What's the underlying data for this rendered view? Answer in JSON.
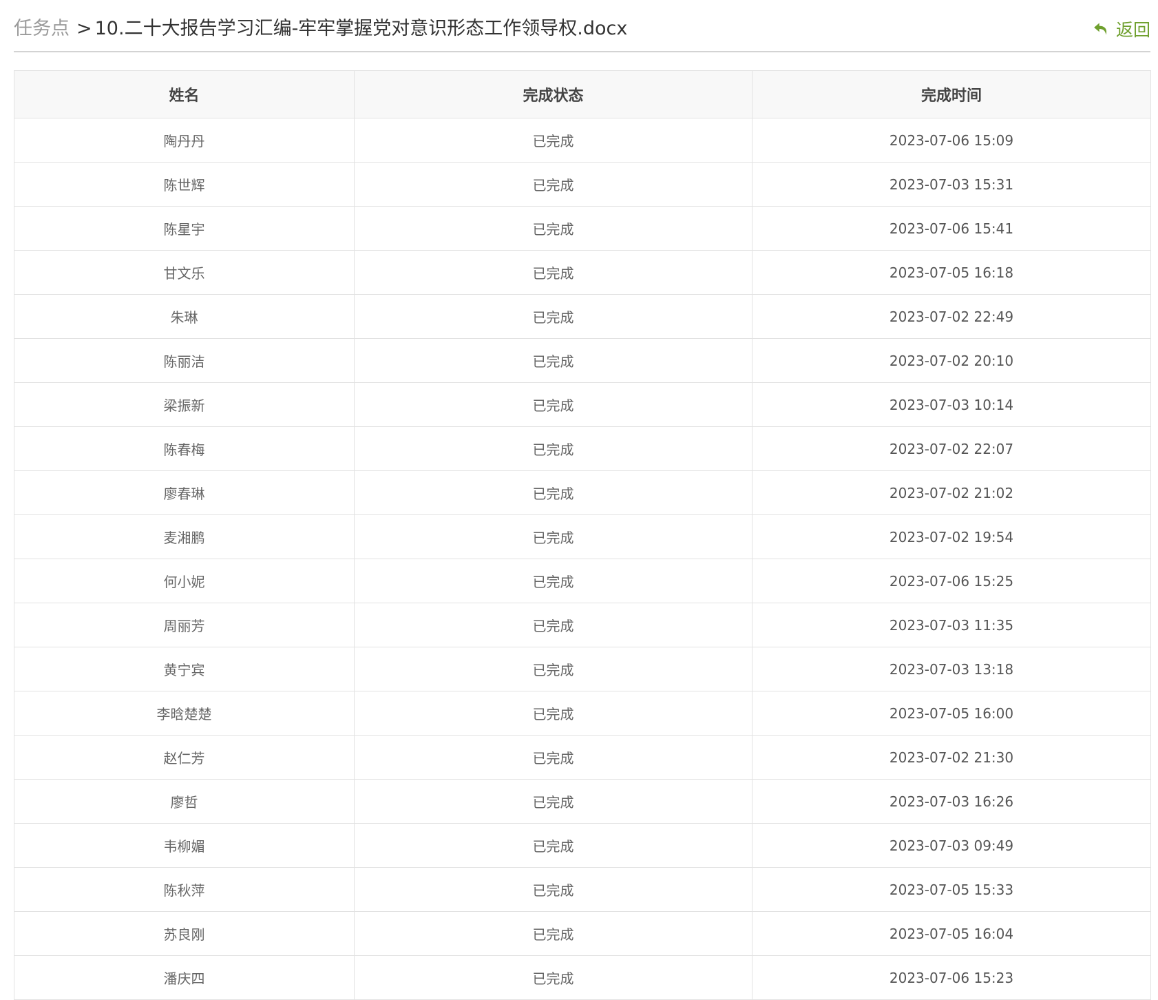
{
  "breadcrumb": {
    "root": "任务点",
    "separator": ">",
    "current": "10.二十大报告学习汇编-牢牢掌握党对意识形态工作领导权.docx"
  },
  "back": {
    "label": "返回",
    "icon": "back-arrow-icon",
    "color": "#6fa02e"
  },
  "table": {
    "headers": [
      "姓名",
      "完成状态",
      "完成时间"
    ],
    "rows": [
      {
        "name": "陶丹丹",
        "status": "已完成",
        "time": "2023-07-06 15:09"
      },
      {
        "name": "陈世辉",
        "status": "已完成",
        "time": "2023-07-03 15:31"
      },
      {
        "name": "陈星宇",
        "status": "已完成",
        "time": "2023-07-06 15:41"
      },
      {
        "name": "甘文乐",
        "status": "已完成",
        "time": "2023-07-05 16:18"
      },
      {
        "name": "朱琳",
        "status": "已完成",
        "time": "2023-07-02 22:49"
      },
      {
        "name": "陈丽洁",
        "status": "已完成",
        "time": "2023-07-02 20:10"
      },
      {
        "name": "梁振新",
        "status": "已完成",
        "time": "2023-07-03 10:14"
      },
      {
        "name": "陈春梅",
        "status": "已完成",
        "time": "2023-07-02 22:07"
      },
      {
        "name": "廖春琳",
        "status": "已完成",
        "time": "2023-07-02 21:02"
      },
      {
        "name": "麦湘鹏",
        "status": "已完成",
        "time": "2023-07-02 19:54"
      },
      {
        "name": "何小妮",
        "status": "已完成",
        "time": "2023-07-06 15:25"
      },
      {
        "name": "周丽芳",
        "status": "已完成",
        "time": "2023-07-03 11:35"
      },
      {
        "name": "黄宁宾",
        "status": "已完成",
        "time": "2023-07-03 13:18"
      },
      {
        "name": "李晗楚楚",
        "status": "已完成",
        "time": "2023-07-05 16:00"
      },
      {
        "name": "赵仁芳",
        "status": "已完成",
        "time": "2023-07-02 21:30"
      },
      {
        "name": "廖哲",
        "status": "已完成",
        "time": "2023-07-03 16:26"
      },
      {
        "name": "韦柳媚",
        "status": "已完成",
        "time": "2023-07-03 09:49"
      },
      {
        "name": "陈秋萍",
        "status": "已完成",
        "time": "2023-07-05 15:33"
      },
      {
        "name": "苏良刚",
        "status": "已完成",
        "time": "2023-07-05 16:04"
      },
      {
        "name": "潘庆四",
        "status": "已完成",
        "time": "2023-07-06 15:23"
      }
    ]
  }
}
